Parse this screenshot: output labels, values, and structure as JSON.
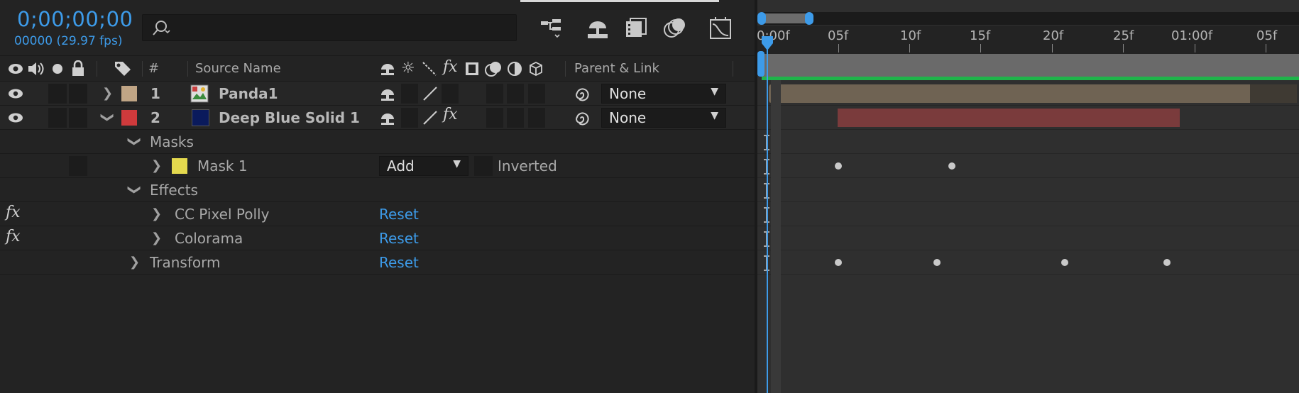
{
  "timecode": "0;00;00;00",
  "frame_info": "00000 (29.97 fps)",
  "search": {
    "placeholder": ""
  },
  "columns": {
    "number": "#",
    "source_name": "Source Name",
    "parent_link": "Parent & Link"
  },
  "layers": [
    {
      "index": "1",
      "name": "Panda1",
      "label_color": "#c0a585",
      "parent": "None",
      "expanded": false
    },
    {
      "index": "2",
      "name": "Deep Blue Solid 1",
      "label_color": "#cf3a3c",
      "solid_color": "#0a1a5c",
      "parent": "None",
      "expanded": true
    }
  ],
  "groups": {
    "masks": "Masks",
    "mask1": {
      "name": "Mask 1",
      "color": "#e4d94e",
      "mode": "Add",
      "inverted_label": "Inverted"
    },
    "effects": "Effects",
    "effect1": {
      "name": "CC Pixel Polly",
      "reset": "Reset",
      "fx": "fx"
    },
    "effect2": {
      "name": "Colorama",
      "reset": "Reset",
      "fx": "fx"
    },
    "transform": {
      "name": "Transform",
      "reset": "Reset"
    }
  },
  "ruler": {
    "labels": [
      "0:00f",
      "05f",
      "10f",
      "15f",
      "20f",
      "25f",
      "01:00f",
      "05f"
    ]
  },
  "colors": {
    "accent": "#3d9be9",
    "panda_bar": "#6f6353",
    "solid_bar": "#7a3b3c",
    "work_area_marker": "#1fb44a"
  }
}
